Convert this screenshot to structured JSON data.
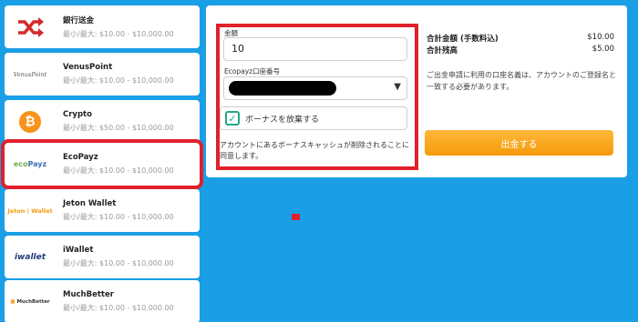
{
  "payment_methods": [
    {
      "id": "bank",
      "name": "銀行送金",
      "range": "最小/最大: $10.00 - $10,000.00",
      "logo_text": ""
    },
    {
      "id": "venuspoint",
      "name": "VenusPoint",
      "range": "最小/最大: $10.00 - $10,000.00",
      "logo_text": "VenusPoint"
    },
    {
      "id": "crypto",
      "name": "Crypto",
      "range": "最小/最大: $50.00 - $10,000.00",
      "logo_text": ""
    },
    {
      "id": "ecopayz",
      "name": "EcoPayz",
      "range": "最小/最大: $10.00 - $10,000.00",
      "logo_text": "ecoPayz"
    },
    {
      "id": "jeton",
      "name": "Jeton Wallet",
      "range": "最小/最大: $10.00 - $10,000.00",
      "logo_text": "Jeton | Wallet"
    },
    {
      "id": "iwallet",
      "name": "iWallet",
      "range": "最小/最大: $10.00 - $10,000.00",
      "logo_text": "iwallet"
    },
    {
      "id": "muchbetter",
      "name": "MuchBetter",
      "range": "最小/最大: $10.00 - $10,000.00",
      "logo_text": "MuchBetter"
    }
  ],
  "form": {
    "amount_label": "金額",
    "amount_value": "10",
    "account_label": "Ecopayz口座番号",
    "waive_bonus_label": "ボーナスを放棄する",
    "notice": "アカウントにあるボーナスキャッシュが削除されることに同意します。"
  },
  "summary": {
    "total_label": "合計金額 (手数料込)",
    "total_value": "$10.00",
    "balance_label": "合計残高",
    "balance_value": "$5.00",
    "note": "ご出金申請に利用の口座名義は、アカウントのご登録名と一致する必要があります。",
    "withdraw_label": "出金する"
  },
  "colors": {
    "background": "#1a9ee6",
    "highlight": "#e0202a",
    "button": "#f5a623",
    "checkbox": "#23a886"
  }
}
